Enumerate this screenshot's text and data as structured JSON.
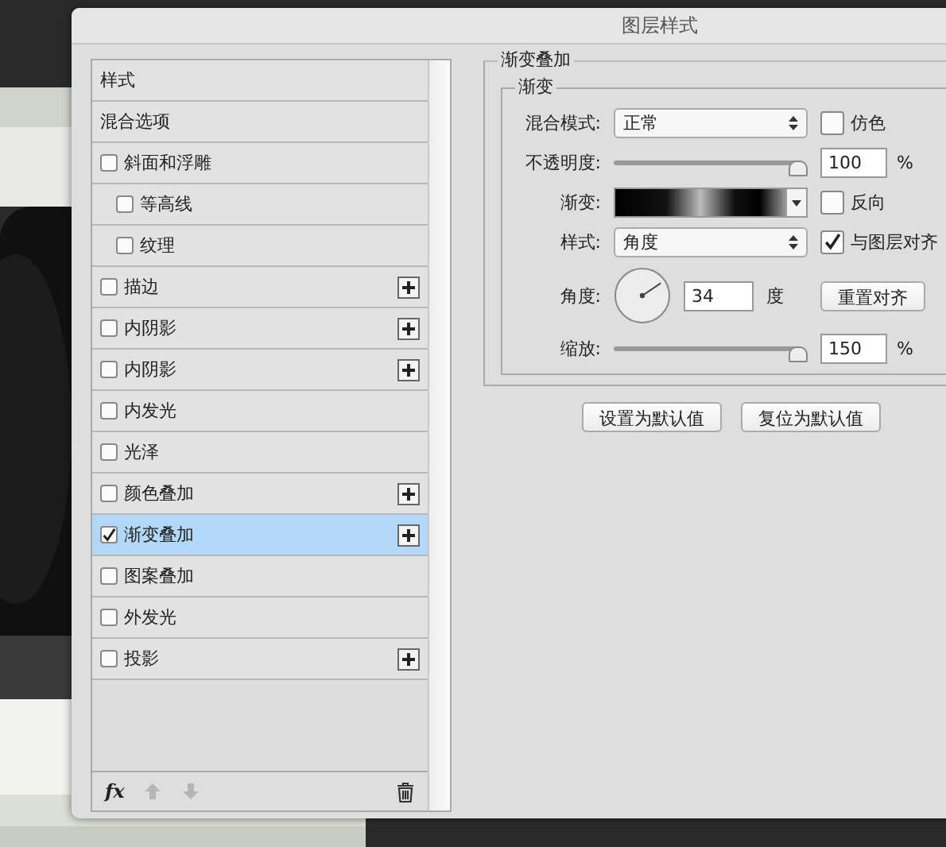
{
  "window": {
    "title": "图层样式"
  },
  "styles_list": {
    "items": [
      {
        "label": "样式",
        "kind": "plain",
        "selected": false
      },
      {
        "label": "混合选项",
        "kind": "plain",
        "selected": false
      },
      {
        "label": "斜面和浮雕",
        "kind": "check",
        "checked": false,
        "add_button": false,
        "selected": false,
        "children": [
          {
            "label": "等高线",
            "kind": "check",
            "checked": false,
            "add_button": false,
            "selected": false
          },
          {
            "label": "纹理",
            "kind": "check",
            "checked": false,
            "add_button": false,
            "selected": false
          }
        ]
      },
      {
        "label": "描边",
        "kind": "check",
        "checked": false,
        "add_button": true,
        "selected": false
      },
      {
        "label": "内阴影",
        "kind": "check",
        "checked": false,
        "add_button": true,
        "selected": false
      },
      {
        "label": "内阴影",
        "kind": "check",
        "checked": false,
        "add_button": true,
        "selected": false
      },
      {
        "label": "内发光",
        "kind": "check",
        "checked": false,
        "add_button": false,
        "selected": false
      },
      {
        "label": "光泽",
        "kind": "check",
        "checked": false,
        "add_button": false,
        "selected": false
      },
      {
        "label": "颜色叠加",
        "kind": "check",
        "checked": false,
        "add_button": true,
        "selected": false
      },
      {
        "label": "渐变叠加",
        "kind": "check",
        "checked": true,
        "add_button": true,
        "selected": true
      },
      {
        "label": "图案叠加",
        "kind": "check",
        "checked": false,
        "add_button": false,
        "selected": false
      },
      {
        "label": "外发光",
        "kind": "check",
        "checked": false,
        "add_button": false,
        "selected": false
      },
      {
        "label": "投影",
        "kind": "check",
        "checked": false,
        "add_button": true,
        "selected": false
      }
    ],
    "footer": {
      "fx_label": "fx"
    }
  },
  "panel": {
    "title": "渐变叠加",
    "group_title": "渐变",
    "blend_mode": {
      "label": "混合模式:",
      "value": "正常"
    },
    "dither": {
      "label": "仿色",
      "checked": false
    },
    "opacity": {
      "label": "不透明度:",
      "level": 1,
      "value": "100",
      "unit": "%"
    },
    "gradient": {
      "label": "渐变:"
    },
    "reverse": {
      "label": "反向",
      "checked": false
    },
    "style": {
      "label": "样式:",
      "value": "角度"
    },
    "align_with_layer": {
      "label": "与图层对齐",
      "checked": true
    },
    "angle": {
      "label": "角度:",
      "value": "34",
      "unit": "度",
      "reset_button": "重置对齐"
    },
    "scale": {
      "label": "缩放:",
      "level": 1,
      "value": "150",
      "unit": "%"
    },
    "buttons": [
      "设置为默认值",
      "复位为默认值"
    ]
  }
}
